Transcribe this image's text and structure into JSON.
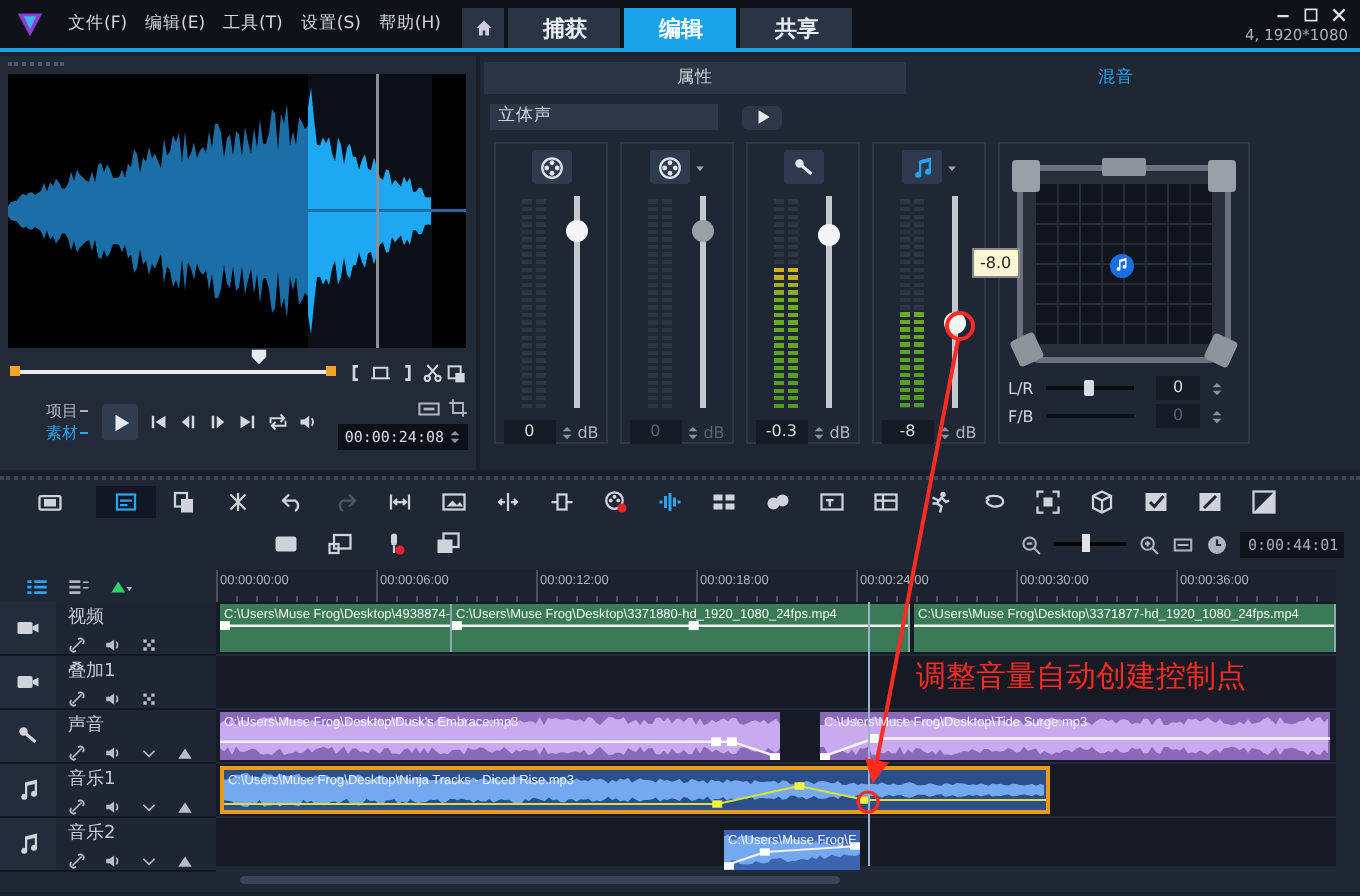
{
  "menu": [
    "文件(F)",
    "编辑(E)",
    "工具(T)",
    "设置(S)",
    "帮助(H)"
  ],
  "tabs": [
    {
      "label": "捕获",
      "selected": false
    },
    {
      "label": "编辑",
      "selected": true
    },
    {
      "label": "共享",
      "selected": false
    }
  ],
  "status": "4, 1920*1080",
  "preview": {
    "scrubber": {
      "level": 0.77
    },
    "modes": [
      {
        "label": "项目",
        "selected": false
      },
      {
        "label": "素材",
        "selected": true
      }
    ],
    "timecode": "00:00:24:08"
  },
  "mixer": {
    "tabs": [
      {
        "label": "属性",
        "selected": false
      },
      {
        "label": "混音",
        "selected": true
      }
    ],
    "mode": "立体声",
    "channels": [
      {
        "kind": "video",
        "dropdown": false,
        "disabled": false,
        "slider": {
          "level": 0.83
        },
        "value": "0",
        "unit": "dB"
      },
      {
        "kind": "overlay",
        "dropdown": true,
        "disabled": true,
        "slider": {
          "level": 0.83
        },
        "value": "0",
        "unit": "dB"
      },
      {
        "kind": "voice",
        "dropdown": false,
        "disabled": false,
        "slider": {
          "level": 0.81
        },
        "meter": {
          "level": 0.67
        },
        "value": "-0.3",
        "unit": "dB"
      },
      {
        "kind": "music",
        "dropdown": true,
        "disabled": false,
        "slider": {
          "level": 0.4
        },
        "meter": {
          "level": 0.45
        },
        "value": "-8",
        "unit": "dB"
      }
    ],
    "tooltip": "-8.0",
    "balance": [
      {
        "label": "L/R",
        "value": "0",
        "disabled": false,
        "level": 0.5
      },
      {
        "label": "F/B",
        "value": "0",
        "disabled": true
      }
    ]
  },
  "toolbar": {
    "views": [
      {
        "selected": false
      },
      {
        "selected": true
      }
    ],
    "redo": {
      "disabled": true
    },
    "zoom": {
      "level": 0.45
    },
    "duration": "0:00:44:01"
  },
  "timeline": {
    "track_views": [
      {
        "selected": true
      },
      {
        "selected": false
      }
    ],
    "ticks": [
      "00:00:00:00",
      "00:00:06:00",
      "00:00:12:00",
      "00:00:18:00",
      "00:00:24:00",
      "00:00:30:00",
      "00:00:36:00"
    ],
    "tracks": [
      {
        "name": "视频",
        "kind": "video",
        "clips": [
          {
            "file": "C:\\Users\\Muse Frog\\Desktop\\4938874-",
            "selected": false
          },
          {
            "file": "C:\\Users\\Muse Frog\\Desktop\\3371880-hd_1920_1080_24fps.mp4",
            "selected": false
          },
          {
            "file": "C:\\Users\\Muse Frog\\Desktop\\3371877-hd_1920_1080_24fps.mp4",
            "selected": false
          }
        ]
      },
      {
        "name": "叠加1",
        "kind": "overlay"
      },
      {
        "name": "声音",
        "kind": "voice",
        "clips": [
          {
            "file": "C:\\Users\\Muse Frog\\Desktop\\Dusk's Embrace.mp3",
            "selected": false
          },
          {
            "file": "C:\\Users\\Muse Frog\\Desktop\\Tide Surge.mp3",
            "selected": false
          }
        ]
      },
      {
        "name": "音乐1",
        "kind": "music",
        "clips": [
          {
            "file": "C:\\Users\\Muse Frog\\Desktop\\Ninja Tracks - Diced Rise.mp3",
            "selected": true
          }
        ]
      },
      {
        "name": "音乐2",
        "kind": "music",
        "clips": [
          {
            "file": "C:\\Users\\Muse Frog\\E",
            "selected": false
          }
        ]
      }
    ]
  },
  "annotation": "调整音量自动创建控制点"
}
